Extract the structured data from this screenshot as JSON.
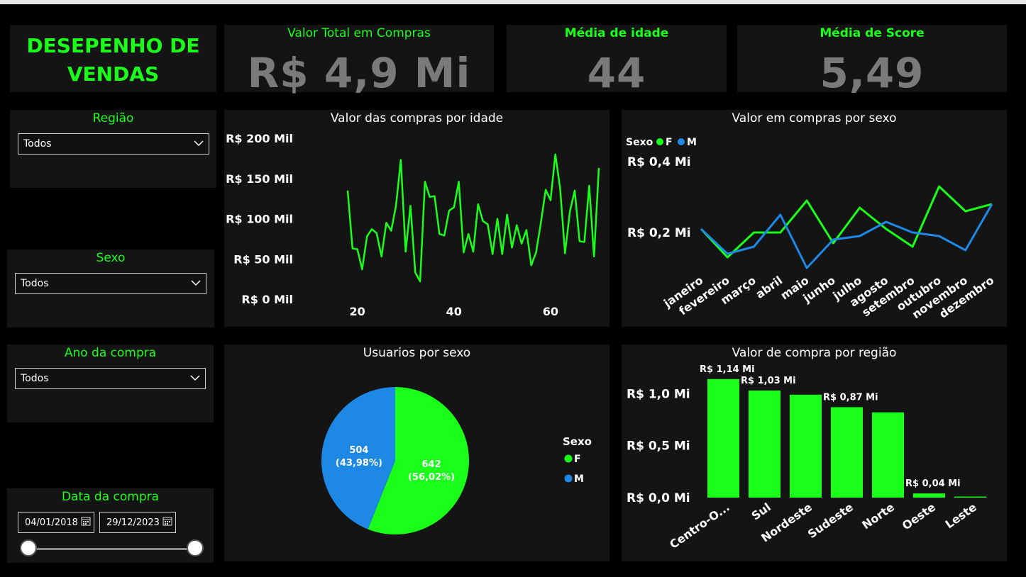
{
  "header": {
    "title_line1": "DESEPENHO DE",
    "title_line2": "VENDAS"
  },
  "kpis": [
    {
      "title": "Valor Total em Compras",
      "value": "R$ 4,9 Mi"
    },
    {
      "title": "Média de idade",
      "value": "44"
    },
    {
      "title": "Média de Score",
      "value": "5,49"
    }
  ],
  "slicers": {
    "regiao": {
      "title": "Região",
      "value": "Todos"
    },
    "sexo": {
      "title": "Sexo",
      "value": "Todos"
    },
    "ano": {
      "title": "Ano da compra",
      "value": "Todos"
    },
    "data": {
      "title": "Data da compra",
      "start": "04/01/2018",
      "end": "29/12/2023"
    }
  },
  "colors": {
    "green": "#1aff1a",
    "blue": "#1e88e5",
    "kpi_value": "#7a7a7a",
    "tile_bg": "#141414"
  },
  "chart_data": [
    {
      "type": "line",
      "title": "Valor das compras por idade",
      "x_ticks": [
        20,
        40,
        60
      ],
      "y_ticks": [
        "R$ 0 Mil",
        "R$ 50 Mil",
        "R$ 100 Mil",
        "R$ 150 Mil",
        "R$ 200 Mil"
      ],
      "ylim": [
        0,
        200
      ],
      "x": [
        18,
        19,
        20,
        21,
        22,
        23,
        24,
        25,
        26,
        27,
        28,
        29,
        30,
        31,
        32,
        33,
        34,
        35,
        36,
        37,
        38,
        39,
        40,
        41,
        42,
        43,
        44,
        45,
        46,
        47,
        48,
        49,
        50,
        51,
        52,
        53,
        54,
        55,
        56,
        57,
        58,
        59,
        60,
        61,
        62,
        63,
        64,
        65,
        66,
        67,
        68,
        69,
        70
      ],
      "values": [
        135,
        63,
        62,
        37,
        78,
        87,
        82,
        53,
        95,
        85,
        116,
        173,
        59,
        116,
        33,
        22,
        146,
        127,
        128,
        81,
        79,
        110,
        114,
        146,
        58,
        81,
        59,
        118,
        97,
        93,
        56,
        100,
        56,
        105,
        64,
        92,
        69,
        86,
        42,
        58,
        95,
        136,
        123,
        180,
        137,
        57,
        109,
        135,
        72,
        71,
        141,
        53,
        163
      ]
    },
    {
      "type": "line",
      "title": "Valor em compras por sexo",
      "legend_title": "Sexo",
      "categories": [
        "janeiro",
        "fevereiro",
        "março",
        "abril",
        "maio",
        "junho",
        "julho",
        "agosto",
        "setembro",
        "outubro",
        "novembro",
        "dezembro"
      ],
      "y_ticks": [
        "R$ 0,2 Mi",
        "R$ 0,4 Mi"
      ],
      "ylim": [
        0,
        0.5
      ],
      "series": [
        {
          "name": "F",
          "color": "#1aff1a",
          "values": [
            0.21,
            0.13,
            0.2,
            0.2,
            0.29,
            0.17,
            0.27,
            0.21,
            0.16,
            0.33,
            0.26,
            0.28
          ]
        },
        {
          "name": "M",
          "color": "#1e88e5",
          "values": [
            0.21,
            0.14,
            0.16,
            0.25,
            0.1,
            0.18,
            0.19,
            0.23,
            0.2,
            0.19,
            0.15,
            0.28
          ]
        }
      ]
    },
    {
      "type": "pie",
      "title": "Usuarios por sexo",
      "legend_title": "Sexo",
      "slices": [
        {
          "name": "F",
          "value": 642,
          "label_value": "642",
          "label_pct": "(56,02%)",
          "color": "#1aff1a"
        },
        {
          "name": "M",
          "value": 504,
          "label_value": "504",
          "label_pct": "(43,98%)",
          "color": "#1e88e5"
        }
      ]
    },
    {
      "type": "bar",
      "title": "Valor de compra por região",
      "categories": [
        "Centro-O...",
        "Sul",
        "Nordeste",
        "Sudeste",
        "Norte",
        "Oeste",
        "Leste"
      ],
      "values": [
        1.14,
        1.03,
        0.99,
        0.87,
        0.82,
        0.04,
        0.01
      ],
      "data_labels": [
        "R$ 1,14 Mi",
        "R$ 1,03 Mi",
        "",
        "R$ 0,87 Mi",
        "",
        "R$ 0,04 Mi",
        ""
      ],
      "y_ticks": [
        "R$ 0,0 Mi",
        "R$ 0,5 Mi",
        "R$ 1,0 Mi"
      ],
      "ylim": [
        0,
        1.2
      ],
      "color": "#1aff1a"
    }
  ]
}
